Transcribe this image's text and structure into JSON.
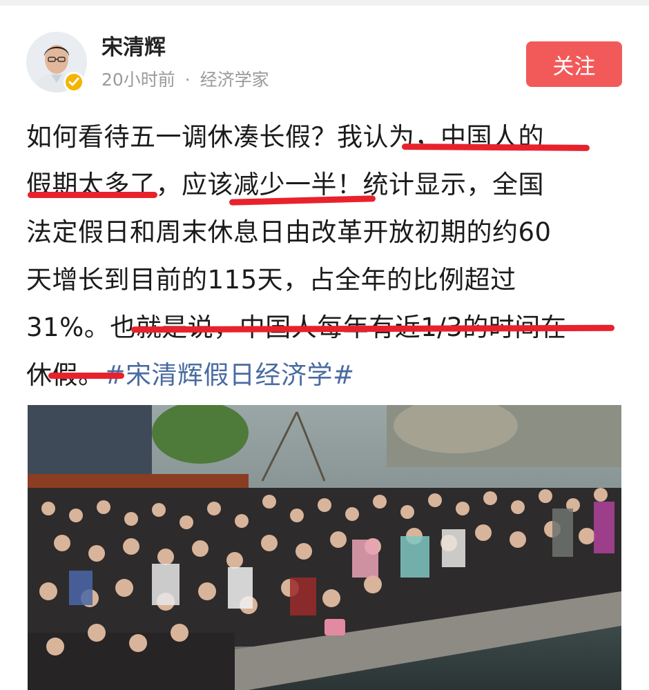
{
  "author": {
    "name": "宋清辉",
    "time": "20小时前",
    "separator": "·",
    "title": "经济学家"
  },
  "follow_label": "关注",
  "post": {
    "text_lines": [
      "如何看待五一调休凑长假？我认为，中国人的",
      "假期太多了，应该减少一半！统计显示，全国",
      "法定假日和周末休息日由改革开放初期的约60",
      "天增长到目前的115天，占全年的比例超过",
      "31%。也就是说，中国人每年有近1/3的时间在"
    ],
    "last_line_text": "休假。",
    "hashtag": "#宋清辉假日经济学#"
  },
  "colors": {
    "follow_button": "#f25a5a",
    "hashtag": "#4a6ba1",
    "underline": "#e8222c",
    "verified_badge": "#f5b400"
  },
  "icons": {
    "avatar": "avatar",
    "verified": "verified-badge-icon"
  }
}
